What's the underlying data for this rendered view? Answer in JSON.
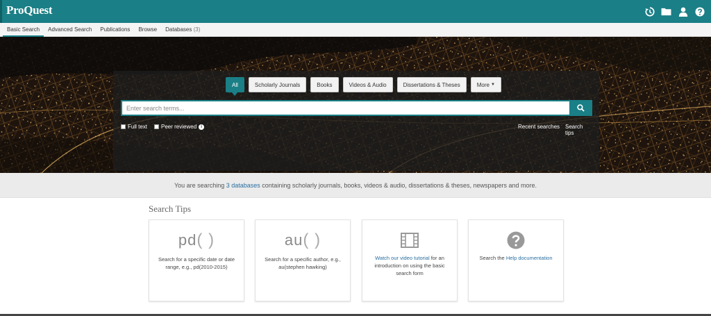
{
  "header": {
    "logo": "ProQuest",
    "icons": [
      "history-icon",
      "folder-icon",
      "user-icon",
      "help-icon"
    ]
  },
  "nav": {
    "items": [
      {
        "label": "Basic Search",
        "active": true
      },
      {
        "label": "Advanced Search"
      },
      {
        "label": "Publications"
      },
      {
        "label": "Browse"
      },
      {
        "label": "Databases",
        "count": "(3)"
      }
    ]
  },
  "search": {
    "tabs": [
      {
        "label": "All",
        "active": true
      },
      {
        "label": "Scholarly Journals"
      },
      {
        "label": "Books"
      },
      {
        "label": "Videos & Audio"
      },
      {
        "label": "Dissertations & Theses"
      },
      {
        "label": "More"
      }
    ],
    "placeholder": "Enter search terms...",
    "full_text_label": "Full text",
    "peer_reviewed_label": "Peer reviewed",
    "recent_searches": "Recent searches",
    "search_tips": "Search tips"
  },
  "strip": {
    "prefix": "You are searching ",
    "link": "3 databases",
    "suffix": " containing scholarly journals, books, videos & audio, dissertations & theses, newspapers and more."
  },
  "tips": {
    "title": "Search Tips",
    "cards": [
      {
        "big_text": "pd",
        "paren": "( )",
        "desc": "Search for a specific date or date range, e.g., pd(2010-2015)"
      },
      {
        "big_text": "au",
        "paren": "( )",
        "desc": "Search for a specific author, e.g., au(stephen hawking)"
      },
      {
        "icon": "film-icon",
        "link": "Watch our video tutorial",
        "desc": " for an introduction on using the basic search form"
      },
      {
        "icon": "question-circle-icon",
        "prefix": "Search the ",
        "link": "Help documentation",
        "desc": ""
      }
    ]
  },
  "colors": {
    "brand": "#1a7f86",
    "link": "#2a6fa0"
  }
}
